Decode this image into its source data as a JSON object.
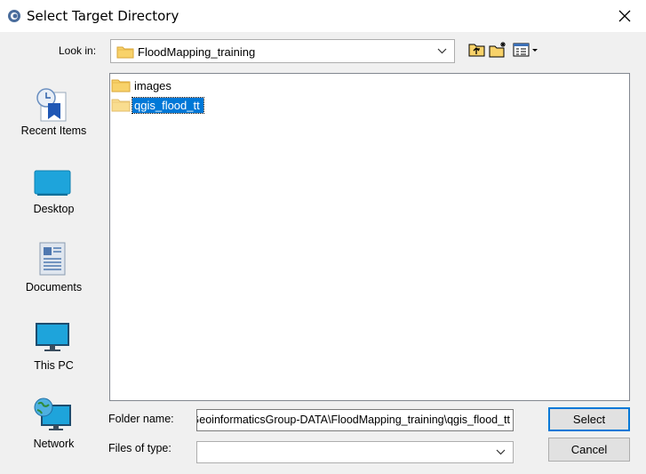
{
  "window": {
    "title": "Select Target Directory",
    "close_glyph": "✕"
  },
  "toolbar": {
    "look_in_label": "Look in:",
    "look_in_value": "FloodMapping_training",
    "icons": [
      "up-one-level-icon",
      "create-new-folder-icon",
      "view-menu-icon"
    ]
  },
  "places": [
    {
      "label": "Recent Items",
      "icon": "recent-items-icon"
    },
    {
      "label": "Desktop",
      "icon": "desktop-icon"
    },
    {
      "label": "Documents",
      "icon": "documents-icon"
    },
    {
      "label": "This PC",
      "icon": "this-pc-icon"
    },
    {
      "label": "Network",
      "icon": "network-icon"
    }
  ],
  "files": [
    {
      "name": "images",
      "selected": false
    },
    {
      "name": "qgis_flood_tt",
      "selected": true
    }
  ],
  "form": {
    "folder_name_label": "Folder name:",
    "folder_name_value": "...\\GeoinformaticsGroup-DATA\\FloodMapping_training\\qgis_flood_tt",
    "files_of_type_label": "Files of type:",
    "files_of_type_value": ""
  },
  "buttons": {
    "select": "Select",
    "cancel": "Cancel"
  },
  "colors": {
    "selection": "#0078d7",
    "folder": "#f8d26a",
    "window_bg": "#f0f0f0"
  }
}
